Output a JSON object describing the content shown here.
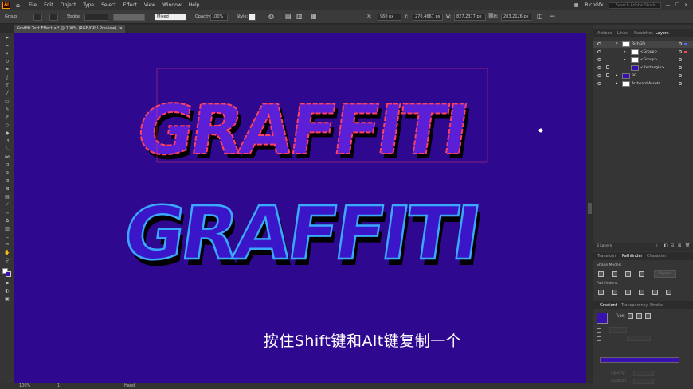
{
  "menubar": {
    "logo": "Ai",
    "items": [
      "File",
      "Edit",
      "Object",
      "Type",
      "Select",
      "Effect",
      "View",
      "Window",
      "Help"
    ],
    "user": "RichGfx",
    "search_placeholder": "Search Adobe Stock"
  },
  "controlbar": {
    "selection": "Group",
    "stroke_label": "Stroke:",
    "mixed": "Mixed",
    "opacity_label": "Opacity:",
    "opacity_value": "100%",
    "style_label": "Style:",
    "x_label": "X:",
    "x_value": "960 px",
    "y_label": "Y:",
    "y_value": "270.4667 px",
    "w_label": "W:",
    "w_value": "827.2377 px",
    "h_label": "H:",
    "h_value": "283.2126 px"
  },
  "document": {
    "tab_title": "Graffiti Text Effect.ai* @ 100% (RGB/GPU Preview)",
    "canvas_color": "#2e0990",
    "artwork_text": "GRAFFITI"
  },
  "statusbar": {
    "zoom": "100%",
    "artboard": "1",
    "tool": "Hand"
  },
  "panels": {
    "top_tabs": [
      "Actions",
      "Links",
      "Swatches",
      "Layers"
    ],
    "active_top_tab": "Layers",
    "layers": [
      {
        "name": "RichGfx",
        "level": 0,
        "selected": true,
        "color": "#4f6cff"
      },
      {
        "name": "<Group>",
        "level": 1,
        "selected": false,
        "color": "#4f6cff"
      },
      {
        "name": "<Group>",
        "level": 1,
        "selected": false,
        "color": "#4f6cff"
      },
      {
        "name": "<Rectangle>",
        "level": 1,
        "selected": false,
        "color": "#4f6cff"
      },
      {
        "name": "BG",
        "level": 0,
        "selected": false,
        "color": "#e04040"
      },
      {
        "name": "Artboard Assets",
        "level": 0,
        "selected": false,
        "color": "#3fbf3f"
      }
    ],
    "layers_count": "3 Layers",
    "mid_tabs": [
      "Transform",
      "Pathfinder",
      "Character"
    ],
    "active_mid_tab": "Pathfinder",
    "shape_modes_label": "Shape Modes:",
    "expand_label": "Expand",
    "pathfinders_label": "Pathfinders:",
    "bottom_tabs": [
      "Gradient",
      "Transparency",
      "Stroke"
    ],
    "active_bottom_tab": "Gradient",
    "type_label": "Type:",
    "opacity_label": "Opacity:",
    "location_label": "Location:",
    "gradient_swatch": "#3811b0"
  },
  "subtitle": "按住Shift键和Alt键复制一个"
}
